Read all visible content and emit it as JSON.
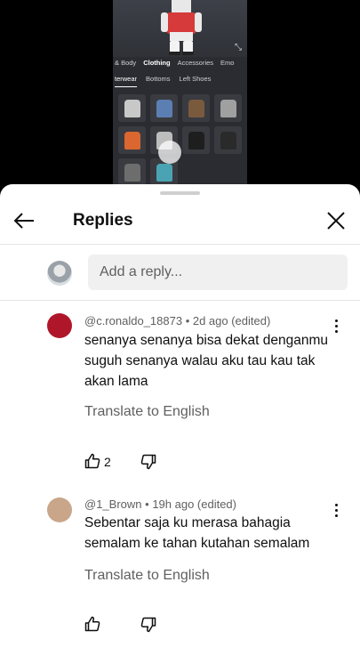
{
  "game": {
    "categories": [
      "& Body",
      "Clothing",
      "Accessories",
      "Emo"
    ],
    "active_category": "Clothing",
    "subcategories": [
      "terwear",
      "Bottoms",
      "Left Shoes"
    ],
    "active_subcategory": "terwear",
    "tile_colors": [
      "#c8c8c8",
      "#5b7fb3",
      "#7a5a3d",
      "#a0a0a0",
      "#d9672f",
      "#bdbdbd",
      "#1e1e1e",
      "#2a2a2a",
      "#6d6d6d",
      "#4aa3b3"
    ]
  },
  "sheet": {
    "title": "Replies",
    "reply_placeholder": "Add a reply..."
  },
  "comments": [
    {
      "author": "@c.ronaldo_18873",
      "time": "2d ago (edited)",
      "text": "senanya senanya bisa dekat denganmu  suguh senanya walau aku tau kau tak akan lama",
      "translate": "Translate to English",
      "likes": "2",
      "avatar_color": "#b0162a"
    },
    {
      "author": "@1_Brown",
      "time": "19h ago (edited)",
      "text": "Sebentar saja ku merasa bahagia semalam ke tahan kutahan semalam",
      "translate": "Translate to English",
      "likes": "",
      "avatar_color": "#c9a68a"
    }
  ]
}
